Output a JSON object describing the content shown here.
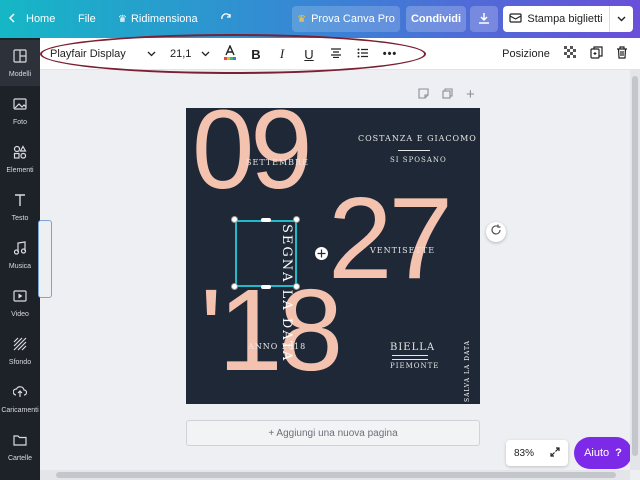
{
  "topbar": {
    "home": "Home",
    "file": "File",
    "resize": "Ridimensiona",
    "try_pro": "Prova Canva Pro",
    "share": "Condividi",
    "print": "Stampa biglietti"
  },
  "sidebar": {
    "items": [
      {
        "label": "Modelli",
        "icon": "templates-icon"
      },
      {
        "label": "Foto",
        "icon": "photo-icon"
      },
      {
        "label": "Elementi",
        "icon": "elements-icon"
      },
      {
        "label": "Testo",
        "icon": "text-icon"
      },
      {
        "label": "Musica",
        "icon": "music-icon"
      },
      {
        "label": "Video",
        "icon": "video-icon"
      },
      {
        "label": "Sfondo",
        "icon": "background-icon"
      },
      {
        "label": "Caricamenti",
        "icon": "upload-icon"
      },
      {
        "label": "Cartelle",
        "icon": "folder-icon"
      }
    ]
  },
  "toolbar": {
    "font": "Playfair Display",
    "font_size": "21,1",
    "position": "Posizione"
  },
  "design": {
    "big_09": "09",
    "big_27": "27",
    "big_18": "'18",
    "names": "COSTANZA E GIACOMO",
    "si_sposano": "SI SPOSANO",
    "settembre": "SETTEMBRE",
    "ventisette": "VENTISETTE",
    "anno": "ANNO 2018",
    "biella": "BIELLA",
    "piemonte": "PIEMONTE",
    "save_date_vertical": "SEGNA LA DATA",
    "side_vertical": "SALVA LA DATA"
  },
  "canvas": {
    "add_page": "+ Aggiungi una nuova pagina",
    "zoom": "83%",
    "help": "Aiuto"
  },
  "colors": {
    "accent_peach": "#f3c3b0",
    "design_bg": "#1f2836",
    "selection": "#24b9c8",
    "help_purple": "#7d2ae8"
  }
}
